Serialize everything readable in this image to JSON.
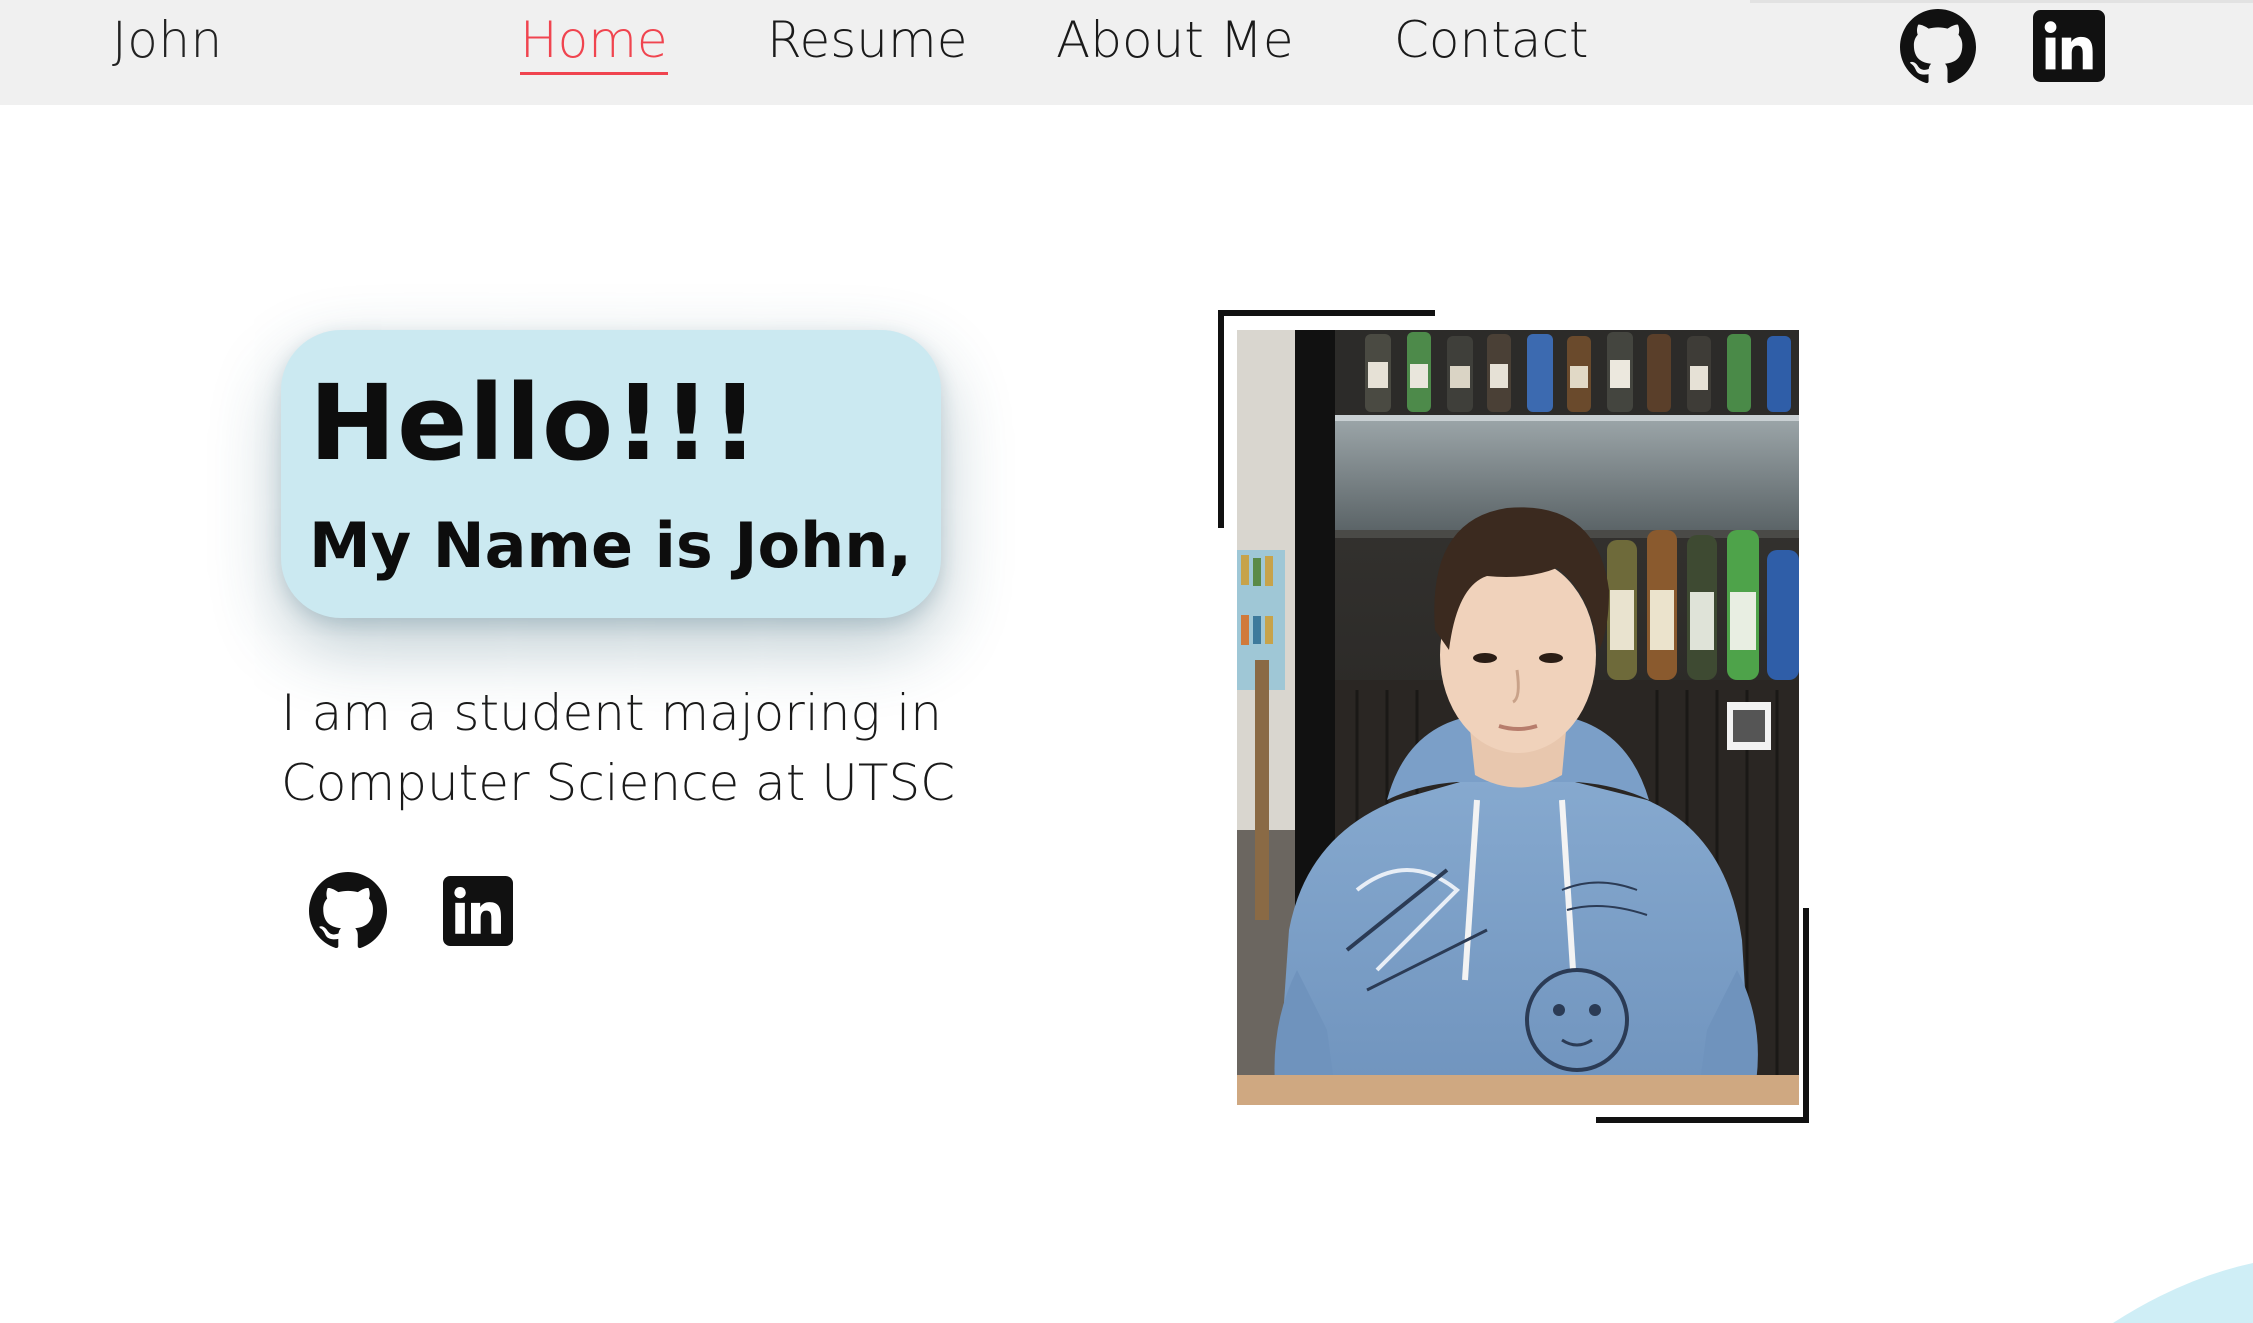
{
  "navbar": {
    "brand": "John",
    "links": [
      {
        "label": "Home",
        "active": true
      },
      {
        "label": "Resume",
        "active": false
      },
      {
        "label": "About Me",
        "active": false
      },
      {
        "label": "Contact",
        "active": false
      }
    ],
    "icons": [
      "github-icon",
      "linkedin-icon"
    ],
    "active_color": "#f0444f",
    "background": "#f0f0f0"
  },
  "hero": {
    "greeting": "Hello!!!",
    "name_line": "My Name is John,",
    "intro_lines": [
      "I am a student majoring in",
      "Computer Science at UTSC"
    ],
    "card_color": "#cbe9f1",
    "icons": [
      "github-icon",
      "linkedin-icon"
    ]
  },
  "photo": {
    "subject": "profile-photo"
  },
  "accent_colors": {
    "corner_decoration": "#cfeef6"
  }
}
